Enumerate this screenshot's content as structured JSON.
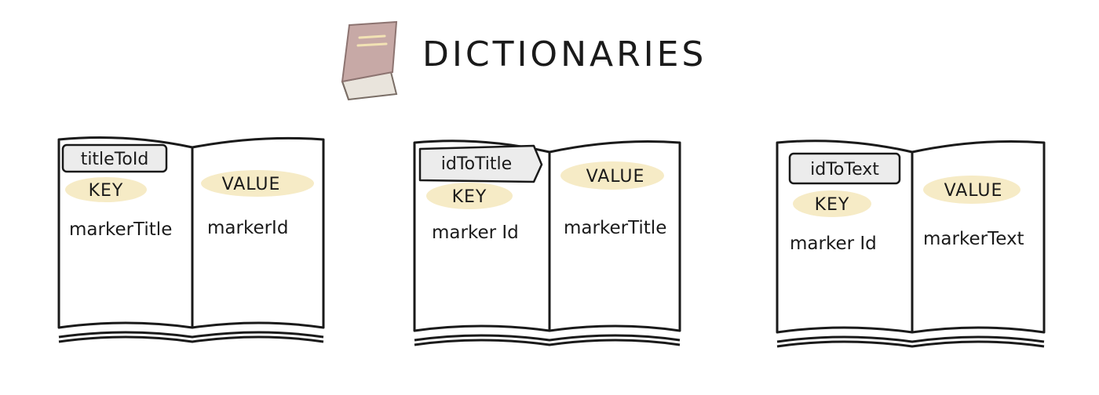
{
  "title": "DICTIONARIES",
  "colors": {
    "ink": "#1a1a1a",
    "highlight": "#f6ebc6",
    "tag_fill": "#ececec",
    "book_cover": "#c7a9a6",
    "book_pages": "#e9e4dc"
  },
  "icons": {
    "title_icon": "book-icon"
  },
  "dictionaries": [
    {
      "name": "titleToId",
      "key_label": "KEY",
      "value_label": "VALUE",
      "key_field": "markerTitle",
      "value_field": "markerId"
    },
    {
      "name": "idToTitle",
      "key_label": "KEY",
      "value_label": "VALUE",
      "key_field": "marker Id",
      "value_field": "markerTitle"
    },
    {
      "name": "idToText",
      "key_label": "KEY",
      "value_label": "VALUE",
      "key_field": "marker Id",
      "value_field": "markerText"
    }
  ]
}
